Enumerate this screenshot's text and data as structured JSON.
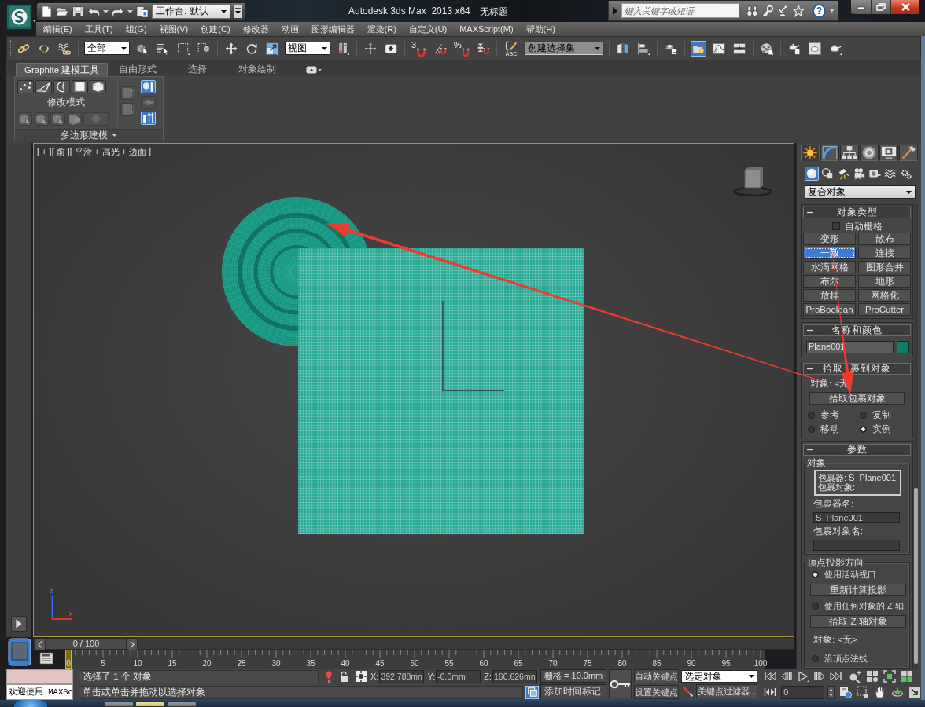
{
  "title_bar": {
    "workspace": "工作台: 默认",
    "title": "Autodesk 3ds Max  2013 x64",
    "document": "无标题",
    "search": {
      "placeholder": "键入关键字或短语"
    },
    "help": "?"
  },
  "menu": [
    "编辑(E)",
    "工具(T)",
    "组(G)",
    "视图(V)",
    "创建(C)",
    "修改器",
    "动画",
    "图形编辑器",
    "渲染(R)",
    "自定义(U)",
    "MAXScript(M)",
    "帮助(H)"
  ],
  "main_toolbar": [
    {
      "kind": "button",
      "selected": false
    },
    {
      "kind": "button",
      "selected": false
    },
    {
      "kind": "button",
      "selected": false
    },
    {
      "kind": "separator"
    },
    {
      "kind": "dropdown",
      "value": "全部",
      "disabled": false
    },
    {
      "kind": "button",
      "selected": false
    },
    {
      "kind": "button",
      "selected": false
    },
    {
      "kind": "button",
      "selected": false
    },
    {
      "kind": "button",
      "selected": false
    },
    {
      "kind": "separator"
    },
    {
      "kind": "button",
      "selected": false
    },
    {
      "kind": "button",
      "selected": false
    },
    {
      "kind": "button",
      "selected": false
    },
    {
      "kind": "dropdown",
      "value": "视图",
      "disabled": false
    },
    {
      "kind": "button",
      "selected": false
    },
    {
      "kind": "separator"
    },
    {
      "kind": "button",
      "selected": false
    },
    {
      "kind": "button",
      "selected": false
    },
    {
      "kind": "separator"
    },
    {
      "kind": "button",
      "selected": false,
      "badge": "3"
    },
    {
      "kind": "button",
      "selected": false
    },
    {
      "kind": "button",
      "selected": false,
      "badge": "%"
    },
    {
      "kind": "button",
      "selected": false
    },
    {
      "kind": "separator"
    },
    {
      "kind": "button",
      "selected": false,
      "badge": "ABC"
    },
    {
      "kind": "dropdown",
      "value": "创建选择集",
      "disabled": true
    },
    {
      "kind": "separator"
    },
    {
      "kind": "button",
      "selected": false
    },
    {
      "kind": "button",
      "selected": false
    },
    {
      "kind": "separator"
    },
    {
      "kind": "button",
      "selected": false
    },
    {
      "kind": "separator"
    },
    {
      "kind": "button",
      "selected": true
    },
    {
      "kind": "button",
      "selected": false
    },
    {
      "kind": "button",
      "selected": false
    },
    {
      "kind": "separator"
    },
    {
      "kind": "button",
      "selected": false
    },
    {
      "kind": "separator"
    },
    {
      "kind": "button",
      "selected": false
    },
    {
      "kind": "button",
      "selected": false
    },
    {
      "kind": "button",
      "selected": false
    }
  ],
  "ribbon": {
    "tabs": [
      {
        "label": "Graphite 建模工具",
        "selected": true
      },
      {
        "label": "自由形式",
        "selected": false
      },
      {
        "label": "选择",
        "selected": false
      },
      {
        "label": "对象绘制",
        "selected": false
      }
    ],
    "panel": {
      "top_tools": [
        {
          "disabled": false
        },
        {
          "disabled": false
        },
        {
          "disabled": false
        },
        {
          "disabled": false
        },
        {
          "disabled": false
        }
      ],
      "label": "修改模式",
      "bottom_tools": [
        {
          "disabled": true
        },
        {
          "disabled": true
        },
        {
          "disabled": true
        },
        {
          "disabled": true
        },
        {
          "disabled": true
        }
      ],
      "side_columns": [
        [
          {
            "selected": false,
            "disabled": true
          },
          {
            "selected": false,
            "disabled": true
          }
        ],
        [
          {
            "selected": true,
            "disabled": false
          },
          {
            "selected": false,
            "disabled": true
          },
          {
            "selected": true,
            "disabled": false
          }
        ]
      ],
      "footer": "多边形建模"
    }
  },
  "viewport": {
    "label": "[ + ][ 前 ][ 平滑 + 高光 + 边面 ]",
    "active": true,
    "axis_labels": [
      "z",
      "x"
    ]
  },
  "command_panel": {
    "tabs": [
      {
        "selected": true
      },
      {
        "selected": false
      },
      {
        "selected": false
      },
      {
        "selected": false
      },
      {
        "selected": false
      },
      {
        "selected": false
      }
    ],
    "categories": [
      {
        "selected": true
      },
      {
        "selected": false
      },
      {
        "selected": false
      },
      {
        "selected": false
      },
      {
        "selected": false
      },
      {
        "selected": false
      },
      {
        "selected": false
      }
    ],
    "dropdown": "复合对象",
    "rollouts": [
      {
        "kind": "object_type",
        "title": "对象类型",
        "expanded": true,
        "auto_grid": {
          "label": "自动栅格",
          "checked": false
        },
        "buttons": [
          {
            "label": "变形",
            "selected": false
          },
          {
            "label": "散布",
            "selected": false
          },
          {
            "label": "一致",
            "selected": true
          },
          {
            "label": "连接",
            "selected": false
          },
          {
            "label": "水滴网格",
            "selected": false
          },
          {
            "label": "图形合并",
            "selected": false
          },
          {
            "label": "布尔",
            "selected": false
          },
          {
            "label": "地形",
            "selected": false
          },
          {
            "label": "放样",
            "selected": false
          },
          {
            "label": "网格化",
            "selected": false
          },
          {
            "label": "ProBoolean",
            "selected": false
          },
          {
            "label": "ProCutter",
            "selected": false
          }
        ]
      },
      {
        "kind": "name_color",
        "title": "名称和颜色",
        "expanded": true,
        "name": "Plane001",
        "color": "#0e7f66"
      },
      {
        "kind": "pick",
        "title": "拾取 裹到对象",
        "expanded": true,
        "object": "对象: <无",
        "button": "拾取包裹对象",
        "options": [
          {
            "label": "参考",
            "selected": false
          },
          {
            "label": "复制",
            "selected": false
          },
          {
            "label": "移动",
            "selected": false
          },
          {
            "label": "实例",
            "selected": true
          }
        ]
      },
      {
        "kind": "parameters",
        "title": "参数",
        "expanded": true,
        "groups": [
          {
            "title": "对象",
            "items": [
              {
                "kind": "listbox",
                "lines": [
                  "包裹器: S_Plane001",
                  "包裹对象:"
                ]
              },
              {
                "kind": "text",
                "text": "包裹器名:"
              },
              {
                "kind": "field",
                "value": "S_Plane001"
              },
              {
                "kind": "text",
                "text": "包裹对象名:"
              },
              {
                "kind": "field"
              }
            ]
          },
          {
            "title": "顶点投影方向",
            "items": [
              {
                "kind": "radio",
                "label": "使用活动视口",
                "selected": true
              },
              {
                "kind": "button",
                "label": "重新计算投影"
              },
              {
                "kind": "radio",
                "label": "使用任何对象的 Z 轴",
                "selected": false
              },
              {
                "kind": "button",
                "label": "拾取 Z 轴对象"
              },
              {
                "kind": "text",
                "text": "对象: <无>"
              },
              {
                "kind": "radio",
                "label": "沿顶点法线",
                "selected": false
              }
            ]
          }
        ]
      }
    ]
  },
  "time_slider": {
    "position": "0 / 100",
    "level": 0,
    "ticks": [
      "0",
      "5",
      "10",
      "15",
      "20",
      "25",
      "30",
      "35",
      "40",
      "45",
      "50",
      "55",
      "60",
      "65",
      "70",
      "75",
      "80",
      "85",
      "90",
      "95",
      "100"
    ]
  },
  "status": {
    "listener_output": "欢迎使用 MAXSc",
    "prompts": [
      "选择了 1 个 对象",
      "单击或单击并拖动以选择对象"
    ],
    "coords": [
      {
        "axis": "X:",
        "value": "392.788mn"
      },
      {
        "axis": "Y:",
        "value": "-0.0mm"
      },
      {
        "axis": "Z:",
        "value": "160.626mn"
      }
    ],
    "grid": "栅格 = 10.0mm",
    "adaptive_toggle": {
      "on": true
    },
    "time_tag": "添加时间标记",
    "auto_key": {
      "label": "自动关键点",
      "on": false
    },
    "set_key": "设置关键点",
    "key_target": "选定对象",
    "key_filters": "关键点过滤器...",
    "frame": "0"
  },
  "taskbar": {
    "buttons": [
      {
        "selected": false
      },
      {
        "selected": true
      },
      {
        "selected": false
      }
    ]
  }
}
